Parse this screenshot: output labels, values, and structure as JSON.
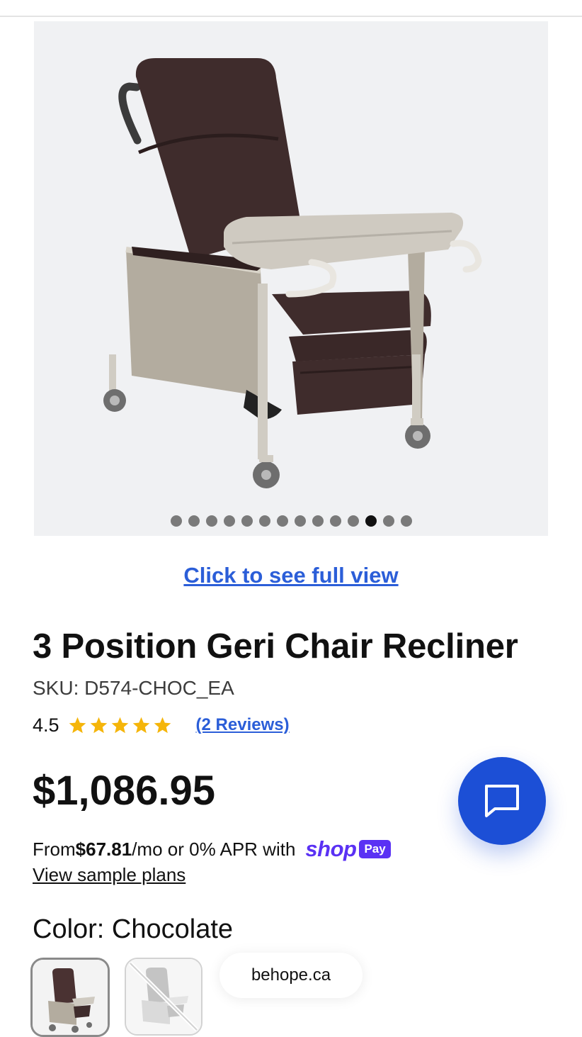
{
  "gallery": {
    "image_alt": "3 Position Geri Chair Recliner in Chocolate with tray",
    "dot_count": 14,
    "active_index": 11
  },
  "full_view_link": "Click to see full view",
  "product": {
    "title": "3 Position Geri Chair Recliner",
    "sku": "SKU: D574-CHOC_EA",
    "rating": "4.5",
    "star_count": 5,
    "reviews_link": "(2 Reviews)",
    "price": "$1,086.95"
  },
  "installments": {
    "prefix": "From ",
    "amount": "$67.81",
    "suffix": "/mo or 0% APR with",
    "shop_word": "shop",
    "pay_badge": "Pay",
    "sample_plans_link": "View sample plans"
  },
  "color": {
    "label": "Color: Chocolate",
    "swatches": [
      {
        "name": "Chocolate",
        "available": true,
        "selected": true
      },
      {
        "name": "Grey",
        "available": false,
        "selected": false
      }
    ]
  },
  "browser": {
    "domain": "behope.ca"
  },
  "colors": {
    "link_blue": "#2b5ed8",
    "chat_button": "#1c4fd6",
    "shop_pay_purple": "#5a31f4",
    "star_gold": "#f5b50a",
    "upholstery": "#3f2c2c"
  },
  "icons": {
    "chat": "chat-bubble-icon",
    "star": "star-icon",
    "unavailable": "strike-through"
  }
}
